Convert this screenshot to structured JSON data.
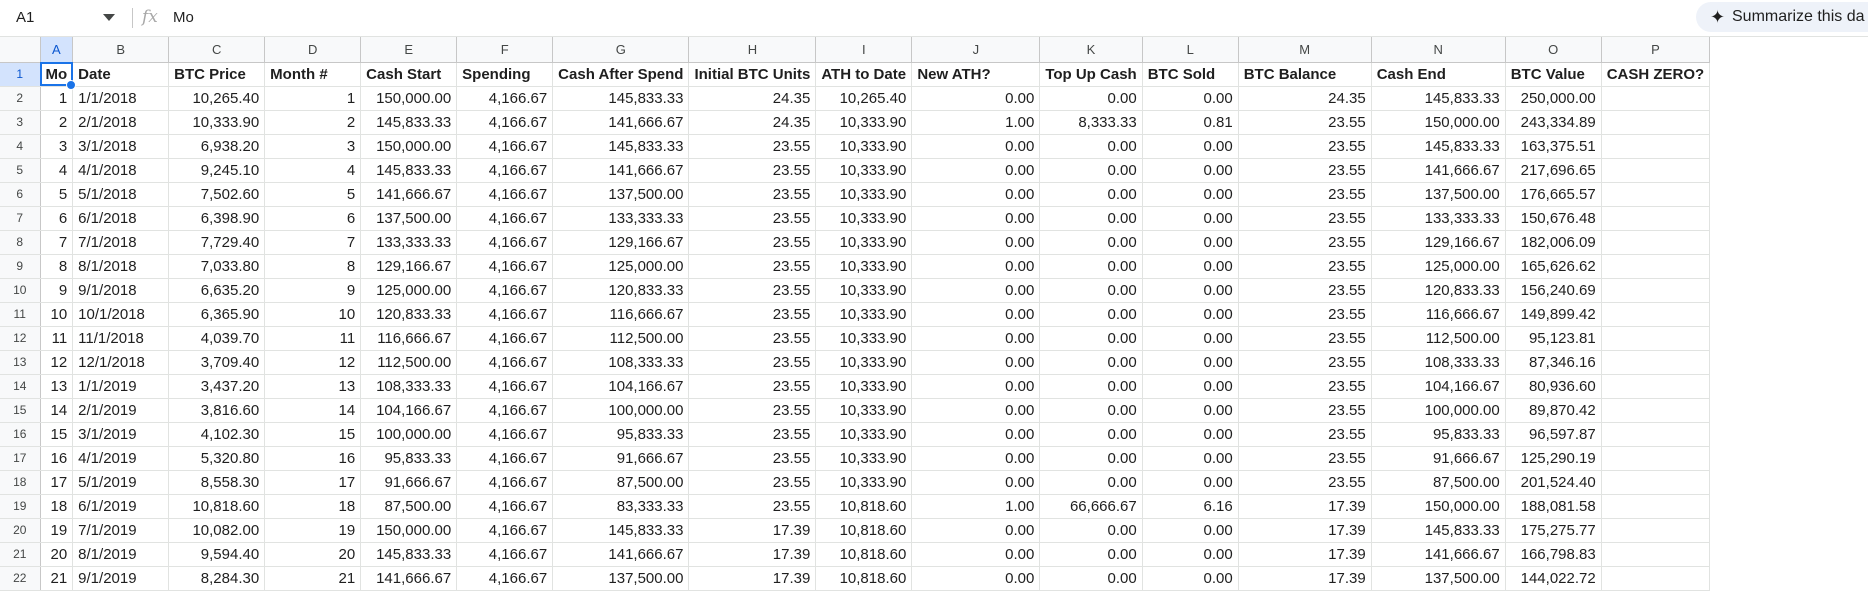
{
  "formula_bar": {
    "cell_ref": "A1",
    "fx": "fx",
    "formula": "Mo",
    "summarize_label": "Summarize this da"
  },
  "columns": [
    "A",
    "B",
    "C",
    "D",
    "E",
    "F",
    "G",
    "H",
    "I",
    "J",
    "K",
    "L",
    "M",
    "N",
    "O",
    "P"
  ],
  "headers": [
    "Mo",
    "Date",
    "BTC Price",
    "Month #",
    "Cash Start",
    "Spending",
    "Cash After Spend",
    "Initial BTC Units",
    "ATH to Date",
    "New ATH?",
    "Top Up Cash",
    "BTC Sold",
    "BTC Balance",
    "Cash End",
    "BTC Value",
    "CASH ZERO?"
  ],
  "rows": [
    [
      "1",
      "1/1/2018",
      "10,265.40",
      "1",
      "150,000.00",
      "4,166.67",
      "145,833.33",
      "24.35",
      "10,265.40",
      "0.00",
      "0.00",
      "0.00",
      "24.35",
      "145,833.33",
      "250,000.00",
      ""
    ],
    [
      "2",
      "2/1/2018",
      "10,333.90",
      "2",
      "145,833.33",
      "4,166.67",
      "141,666.67",
      "24.35",
      "10,333.90",
      "1.00",
      "8,333.33",
      "0.81",
      "23.55",
      "150,000.00",
      "243,334.89",
      ""
    ],
    [
      "3",
      "3/1/2018",
      "6,938.20",
      "3",
      "150,000.00",
      "4,166.67",
      "145,833.33",
      "23.55",
      "10,333.90",
      "0.00",
      "0.00",
      "0.00",
      "23.55",
      "145,833.33",
      "163,375.51",
      ""
    ],
    [
      "4",
      "4/1/2018",
      "9,245.10",
      "4",
      "145,833.33",
      "4,166.67",
      "141,666.67",
      "23.55",
      "10,333.90",
      "0.00",
      "0.00",
      "0.00",
      "23.55",
      "141,666.67",
      "217,696.65",
      ""
    ],
    [
      "5",
      "5/1/2018",
      "7,502.60",
      "5",
      "141,666.67",
      "4,166.67",
      "137,500.00",
      "23.55",
      "10,333.90",
      "0.00",
      "0.00",
      "0.00",
      "23.55",
      "137,500.00",
      "176,665.57",
      ""
    ],
    [
      "6",
      "6/1/2018",
      "6,398.90",
      "6",
      "137,500.00",
      "4,166.67",
      "133,333.33",
      "23.55",
      "10,333.90",
      "0.00",
      "0.00",
      "0.00",
      "23.55",
      "133,333.33",
      "150,676.48",
      ""
    ],
    [
      "7",
      "7/1/2018",
      "7,729.40",
      "7",
      "133,333.33",
      "4,166.67",
      "129,166.67",
      "23.55",
      "10,333.90",
      "0.00",
      "0.00",
      "0.00",
      "23.55",
      "129,166.67",
      "182,006.09",
      ""
    ],
    [
      "8",
      "8/1/2018",
      "7,033.80",
      "8",
      "129,166.67",
      "4,166.67",
      "125,000.00",
      "23.55",
      "10,333.90",
      "0.00",
      "0.00",
      "0.00",
      "23.55",
      "125,000.00",
      "165,626.62",
      ""
    ],
    [
      "9",
      "9/1/2018",
      "6,635.20",
      "9",
      "125,000.00",
      "4,166.67",
      "120,833.33",
      "23.55",
      "10,333.90",
      "0.00",
      "0.00",
      "0.00",
      "23.55",
      "120,833.33",
      "156,240.69",
      ""
    ],
    [
      "10",
      "10/1/2018",
      "6,365.90",
      "10",
      "120,833.33",
      "4,166.67",
      "116,666.67",
      "23.55",
      "10,333.90",
      "0.00",
      "0.00",
      "0.00",
      "23.55",
      "116,666.67",
      "149,899.42",
      ""
    ],
    [
      "11",
      "11/1/2018",
      "4,039.70",
      "11",
      "116,666.67",
      "4,166.67",
      "112,500.00",
      "23.55",
      "10,333.90",
      "0.00",
      "0.00",
      "0.00",
      "23.55",
      "112,500.00",
      "95,123.81",
      ""
    ],
    [
      "12",
      "12/1/2018",
      "3,709.40",
      "12",
      "112,500.00",
      "4,166.67",
      "108,333.33",
      "23.55",
      "10,333.90",
      "0.00",
      "0.00",
      "0.00",
      "23.55",
      "108,333.33",
      "87,346.16",
      ""
    ],
    [
      "13",
      "1/1/2019",
      "3,437.20",
      "13",
      "108,333.33",
      "4,166.67",
      "104,166.67",
      "23.55",
      "10,333.90",
      "0.00",
      "0.00",
      "0.00",
      "23.55",
      "104,166.67",
      "80,936.60",
      ""
    ],
    [
      "14",
      "2/1/2019",
      "3,816.60",
      "14",
      "104,166.67",
      "4,166.67",
      "100,000.00",
      "23.55",
      "10,333.90",
      "0.00",
      "0.00",
      "0.00",
      "23.55",
      "100,000.00",
      "89,870.42",
      ""
    ],
    [
      "15",
      "3/1/2019",
      "4,102.30",
      "15",
      "100,000.00",
      "4,166.67",
      "95,833.33",
      "23.55",
      "10,333.90",
      "0.00",
      "0.00",
      "0.00",
      "23.55",
      "95,833.33",
      "96,597.87",
      ""
    ],
    [
      "16",
      "4/1/2019",
      "5,320.80",
      "16",
      "95,833.33",
      "4,166.67",
      "91,666.67",
      "23.55",
      "10,333.90",
      "0.00",
      "0.00",
      "0.00",
      "23.55",
      "91,666.67",
      "125,290.19",
      ""
    ],
    [
      "17",
      "5/1/2019",
      "8,558.30",
      "17",
      "91,666.67",
      "4,166.67",
      "87,500.00",
      "23.55",
      "10,333.90",
      "0.00",
      "0.00",
      "0.00",
      "23.55",
      "87,500.00",
      "201,524.40",
      ""
    ],
    [
      "18",
      "6/1/2019",
      "10,818.60",
      "18",
      "87,500.00",
      "4,166.67",
      "83,333.33",
      "23.55",
      "10,818.60",
      "1.00",
      "66,666.67",
      "6.16",
      "17.39",
      "150,000.00",
      "188,081.58",
      ""
    ],
    [
      "19",
      "7/1/2019",
      "10,082.00",
      "19",
      "150,000.00",
      "4,166.67",
      "145,833.33",
      "17.39",
      "10,818.60",
      "0.00",
      "0.00",
      "0.00",
      "17.39",
      "145,833.33",
      "175,275.77",
      ""
    ],
    [
      "20",
      "8/1/2019",
      "9,594.40",
      "20",
      "145,833.33",
      "4,166.67",
      "141,666.67",
      "17.39",
      "10,818.60",
      "0.00",
      "0.00",
      "0.00",
      "17.39",
      "141,666.67",
      "166,798.83",
      ""
    ],
    [
      "21",
      "9/1/2019",
      "8,284.30",
      "21",
      "141,666.67",
      "4,166.67",
      "137,500.00",
      "17.39",
      "10,818.60",
      "0.00",
      "0.00",
      "0.00",
      "17.39",
      "137,500.00",
      "144,022.72",
      ""
    ]
  ],
  "row_numbers": [
    "1",
    "2",
    "3",
    "4",
    "5",
    "6",
    "7",
    "8",
    "9",
    "10",
    "11",
    "12",
    "13",
    "14",
    "15",
    "16",
    "17",
    "18",
    "19",
    "20",
    "21",
    "22"
  ],
  "colors": {
    "selection": "#1a73e8",
    "header_bg": "#f8f9fa",
    "gridline": "#e1e3e1"
  }
}
